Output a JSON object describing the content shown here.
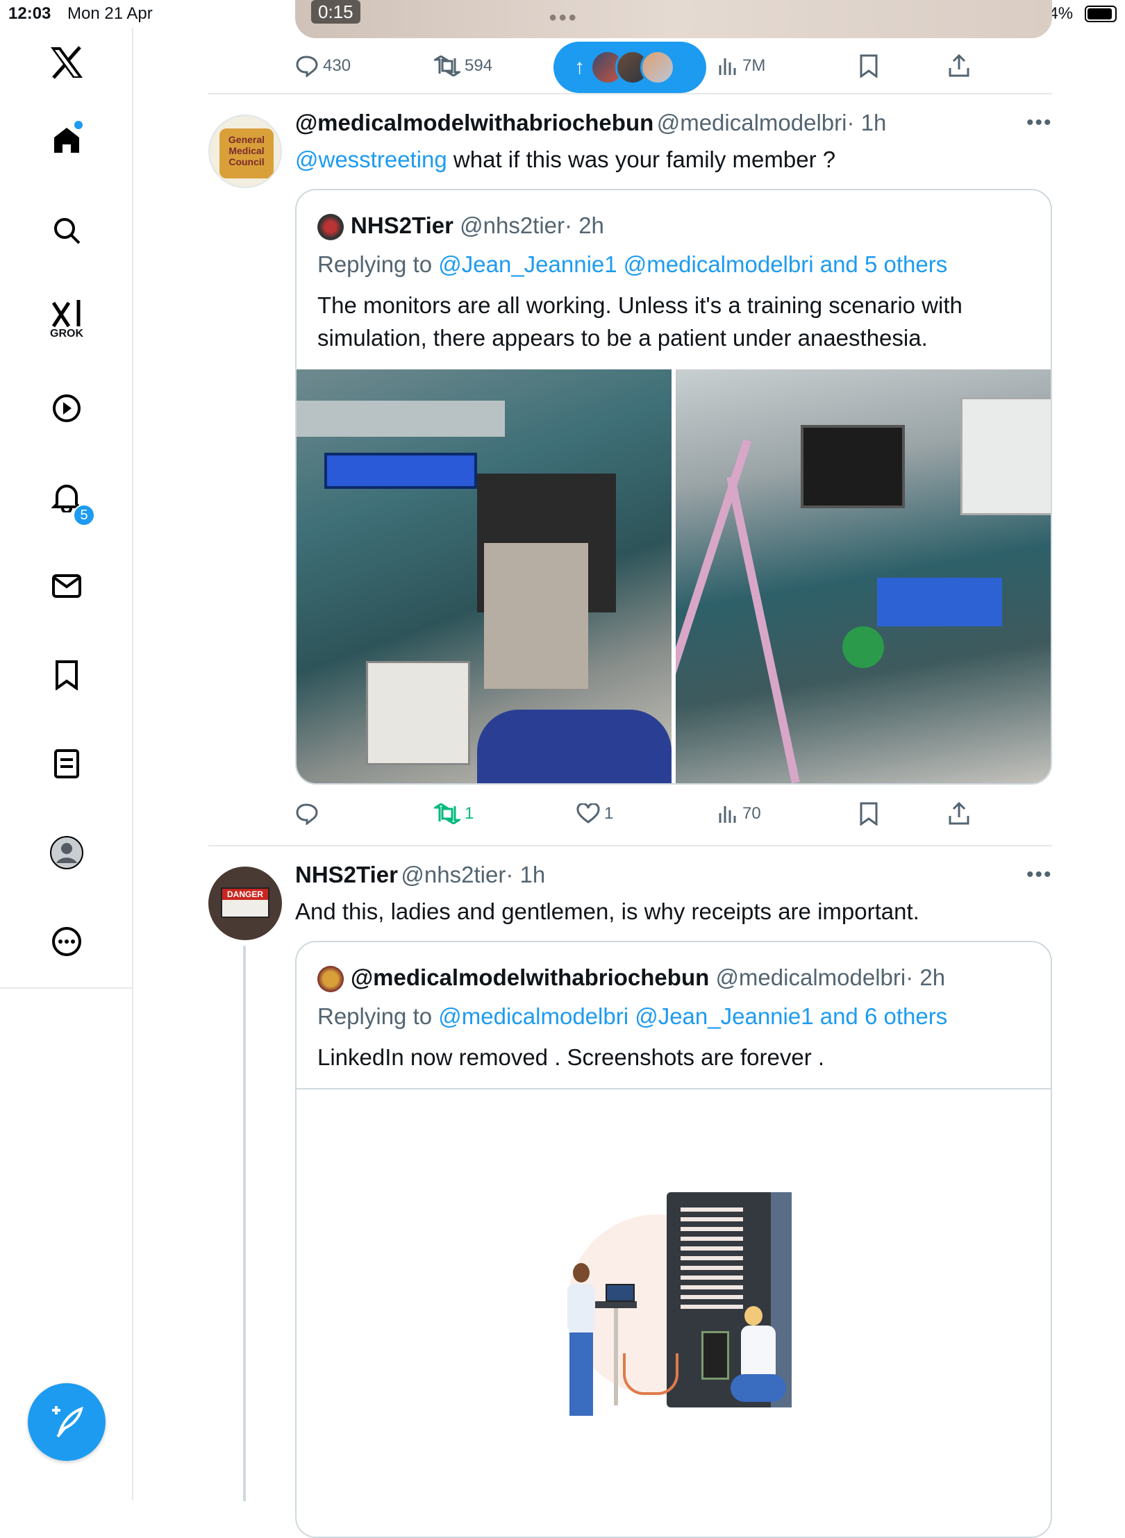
{
  "status_bar": {
    "time": "12:03",
    "date": "Mon 21 Apr",
    "battery": "94%"
  },
  "sidebar": {
    "items": [
      {
        "name": "x-logo-icon"
      },
      {
        "name": "home-icon",
        "has_dot": true
      },
      {
        "name": "search-icon"
      },
      {
        "name": "grok-icon",
        "label": "GROK"
      },
      {
        "name": "video-icon"
      },
      {
        "name": "notifications-icon",
        "badge": "5"
      },
      {
        "name": "messages-icon"
      },
      {
        "name": "bookmarks-icon"
      },
      {
        "name": "lists-icon"
      },
      {
        "name": "profile-icon"
      },
      {
        "name": "more-icon"
      }
    ],
    "compose_icon": "compose-icon"
  },
  "top_tweet": {
    "video_duration": "0:15",
    "replies": "430",
    "reposts": "594",
    "views": "7M"
  },
  "new_posts_pill": {
    "arrow": "↑"
  },
  "tweet1": {
    "username": "@medicalmodelwithabriochebun",
    "handle": "@medicalmodelbri",
    "time": "· 1h",
    "mention": "@wesstreeting",
    "text": " what if this was your family member ?",
    "avatar_text": "General Medical Council",
    "quote": {
      "username": "NHS2Tier",
      "handle": "@nhs2tier",
      "time": "· 2h",
      "replying_prefix": "Replying to ",
      "replying_to": "@Jean_Jeannie1 @medicalmodelbri and 5 others",
      "text_line1": "The monitors are all working. Unless it's a training scenario with",
      "text_line2": "simulation, there appears to be a patient under anaesthesia."
    },
    "replies": "",
    "reposts": "1",
    "likes": "1",
    "views": "70"
  },
  "tweet2": {
    "username": "NHS2Tier",
    "handle": "@nhs2tier",
    "time": "· 1h",
    "text": "And this, ladies and gentlemen, is why receipts are important.",
    "avatar_text": "DANGER",
    "quote": {
      "username": "@medicalmodelwithabriochebun",
      "handle": "@medicalmodelbri",
      "time": "· 2h",
      "replying_prefix": "Replying to ",
      "replying_to": "@medicalmodelbri @Jean_Jeannie1 and 6 others",
      "text": "LinkedIn now removed . Screenshots are forever ."
    }
  },
  "colors": {
    "accent": "#1d9bf0",
    "repost_green": "#00ba7c",
    "muted": "#536471"
  }
}
